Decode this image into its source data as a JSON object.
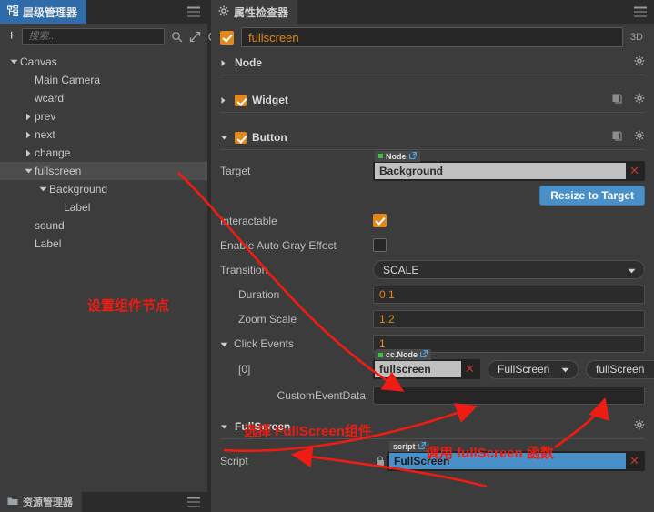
{
  "hierarchy": {
    "tab_label": "层级管理器",
    "tab_icon": "hierarchy-icon",
    "add_label": "+",
    "search_placeholder": "搜索...",
    "search_value": "",
    "bottom_tab_label": "资源管理器",
    "tree": [
      {
        "label": "Canvas",
        "depth": 0,
        "arrow": "down",
        "selected": false
      },
      {
        "label": "Main Camera",
        "depth": 1,
        "arrow": "none",
        "selected": false
      },
      {
        "label": "wcard",
        "depth": 1,
        "arrow": "none",
        "selected": false
      },
      {
        "label": "prev",
        "depth": 1,
        "arrow": "right",
        "selected": false
      },
      {
        "label": "next",
        "depth": 1,
        "arrow": "right",
        "selected": false
      },
      {
        "label": "change",
        "depth": 1,
        "arrow": "right",
        "selected": false
      },
      {
        "label": "fullscreen",
        "depth": 1,
        "arrow": "down",
        "selected": true
      },
      {
        "label": "Background",
        "depth": 2,
        "arrow": "down",
        "selected": false
      },
      {
        "label": "Label",
        "depth": 3,
        "arrow": "none",
        "selected": false
      },
      {
        "label": "sound",
        "depth": 1,
        "arrow": "none",
        "selected": false
      },
      {
        "label": "Label",
        "depth": 1,
        "arrow": "none",
        "selected": false
      }
    ]
  },
  "inspector": {
    "tab_label": "属性检查器",
    "tab_icon": "gear-icon",
    "node_enabled": true,
    "node_name": "fullscreen",
    "three_d_label": "3D",
    "sections": {
      "node": {
        "title": "Node",
        "expanded": false
      },
      "widget": {
        "title": "Widget",
        "expanded": false,
        "enabled": true
      },
      "button": {
        "title": "Button",
        "expanded": true,
        "enabled": true
      },
      "fullscreen": {
        "title": "FullScreen",
        "expanded": true
      }
    },
    "button_props": {
      "target_label": "Target",
      "target_tag": "Node",
      "target_value": "Background",
      "resize_label": "Resize to Target",
      "interactable_label": "Interactable",
      "interactable_value": true,
      "auto_gray_label": "Enable Auto Gray Effect",
      "auto_gray_value": false,
      "transition_label": "Transition",
      "transition_value": "SCALE",
      "duration_label": "Duration",
      "duration_value": "0.1",
      "zoom_scale_label": "Zoom Scale",
      "zoom_scale_value": "1.2",
      "click_events_label": "Click Events",
      "click_events_count": "1",
      "event_index_label": "[0]",
      "event_tag": "cc.Node",
      "event_node_value": "fullscreen",
      "event_component_value": "FullScreen",
      "event_handler_value": "fullScreen",
      "custom_event_data_label": "CustomEventData",
      "custom_event_data_value": ""
    },
    "fullscreen_props": {
      "script_label": "Script",
      "script_tag": "script",
      "script_value": "FullScreen"
    }
  },
  "annotations": [
    {
      "text": "设置组件节点",
      "name": "annotation-set-component-node"
    },
    {
      "text": "选择 FullScreen组件",
      "name": "annotation-select-fullscreen-component"
    },
    {
      "text": "调用 fullScreen 函数",
      "name": "annotation-call-fullscreen-function"
    }
  ],
  "colors": {
    "accent_orange": "#e08a1e",
    "accent_blue": "#4a90c8",
    "annotation_red": "#ee1c12",
    "tab_active_blue": "#2f6ca8",
    "panel_bg": "#3c3c3c",
    "field_bg": "#262626",
    "green_dot": "#3fc23f"
  }
}
